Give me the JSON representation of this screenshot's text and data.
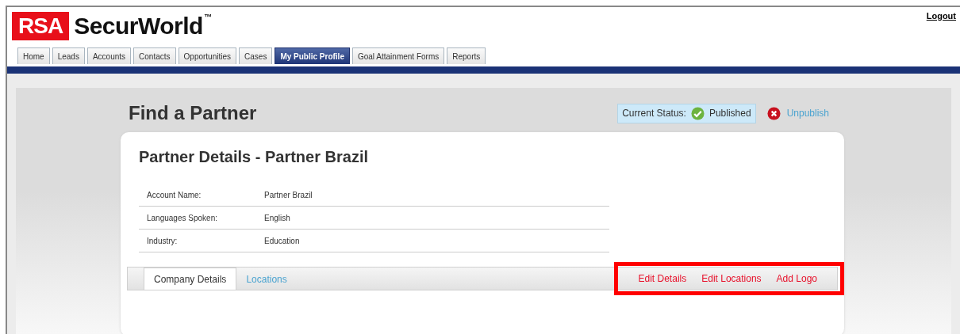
{
  "header": {
    "logo": {
      "mark": "RSA",
      "name": "SecurWorld",
      "trademark": "™"
    },
    "logout": "Logout"
  },
  "tabs": [
    {
      "label": "Home",
      "selected": false
    },
    {
      "label": "Leads",
      "selected": false
    },
    {
      "label": "Accounts",
      "selected": false
    },
    {
      "label": "Contacts",
      "selected": false
    },
    {
      "label": "Opportunities",
      "selected": false
    },
    {
      "label": "Cases",
      "selected": false
    },
    {
      "label": "My Public Profile",
      "selected": true
    },
    {
      "label": "Goal Attainment Forms",
      "selected": false
    },
    {
      "label": "Reports",
      "selected": false
    }
  ],
  "page_title": "Find a Partner",
  "status": {
    "label": "Current Status:",
    "value": "Published",
    "published": true,
    "action": "Unpublish"
  },
  "card": {
    "title": "Partner Details - Partner Brazil",
    "details": [
      {
        "label": "Account Name:",
        "value": "Partner Brazil"
      },
      {
        "label": "Languages Spoken:",
        "value": "English"
      },
      {
        "label": "Industry:",
        "value": "Education"
      }
    ],
    "subtabs": [
      {
        "label": "Company Details",
        "selected": true
      },
      {
        "label": "Locations",
        "selected": false
      }
    ],
    "actions": {
      "highlighted": true,
      "links": [
        "Edit Details",
        "Edit Locations",
        "Add Logo"
      ]
    }
  }
}
